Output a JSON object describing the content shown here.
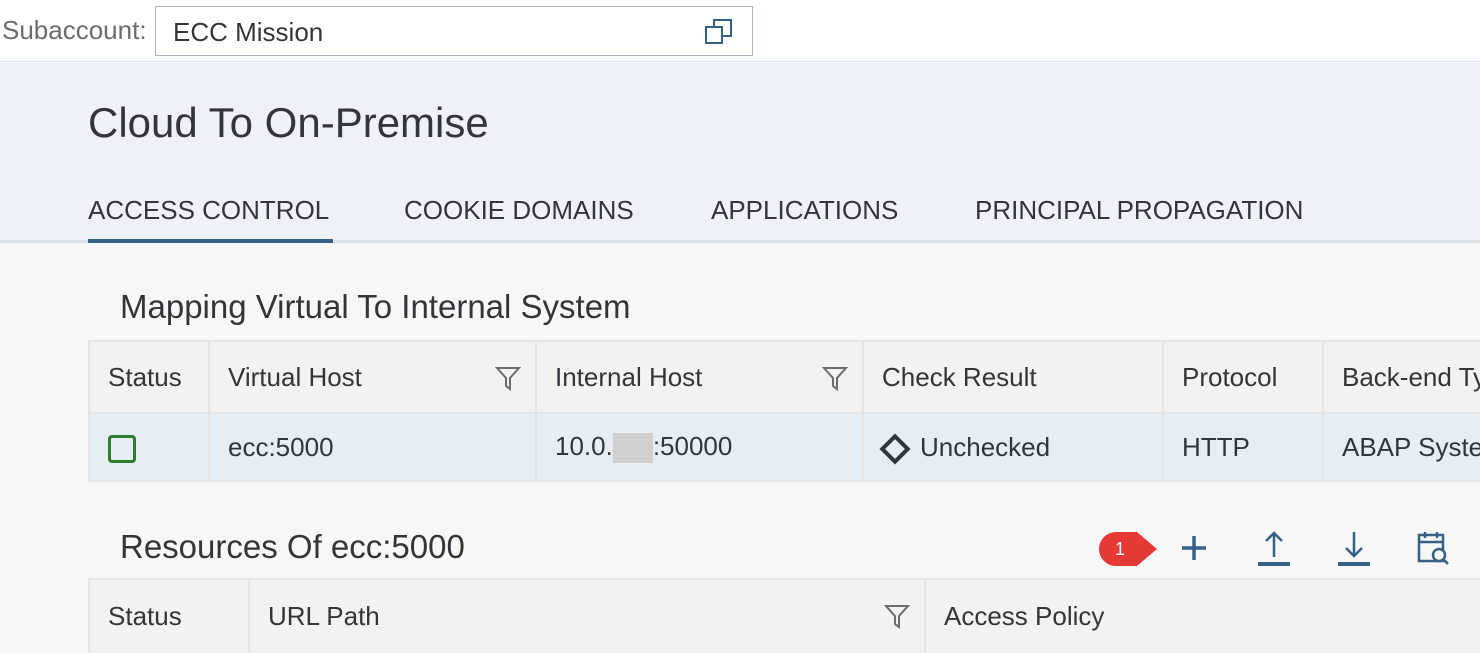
{
  "topbar": {
    "subaccount_label": "Subaccount:",
    "subaccount_value": "ECC Mission",
    "copy_icon": "copy-window-icon"
  },
  "page": {
    "title": "Cloud To On-Premise"
  },
  "tabs": [
    {
      "label": "ACCESS CONTROL",
      "active": true
    },
    {
      "label": "COOKIE DOMAINS",
      "active": false
    },
    {
      "label": "APPLICATIONS",
      "active": false
    },
    {
      "label": "PRINCIPAL PROPAGATION",
      "active": false
    }
  ],
  "mapping": {
    "title": "Mapping Virtual To Internal System",
    "columns": [
      "Status",
      "Virtual Host",
      "Internal Host",
      "Check Result",
      "Protocol",
      "Back-end Type"
    ],
    "row": {
      "virtual_host": "ecc:5000",
      "internal_host_prefix": "10.0.",
      "internal_host_suffix": ":50000",
      "check_result": "Unchecked",
      "protocol": "HTTP",
      "backend_type": "ABAP System"
    }
  },
  "resources": {
    "title": "Resources Of ecc:5000",
    "columns": [
      "Status",
      "URL Path",
      "Access Policy"
    ],
    "toolbar": [
      "add-icon",
      "upload-icon",
      "download-icon",
      "calendar-search-icon"
    ]
  },
  "annotation": {
    "label": "1",
    "color": "#e53935"
  },
  "colors": {
    "accent": "#346187",
    "status_ok": "#2b7c2b",
    "header_bg": "#edf2f8"
  }
}
